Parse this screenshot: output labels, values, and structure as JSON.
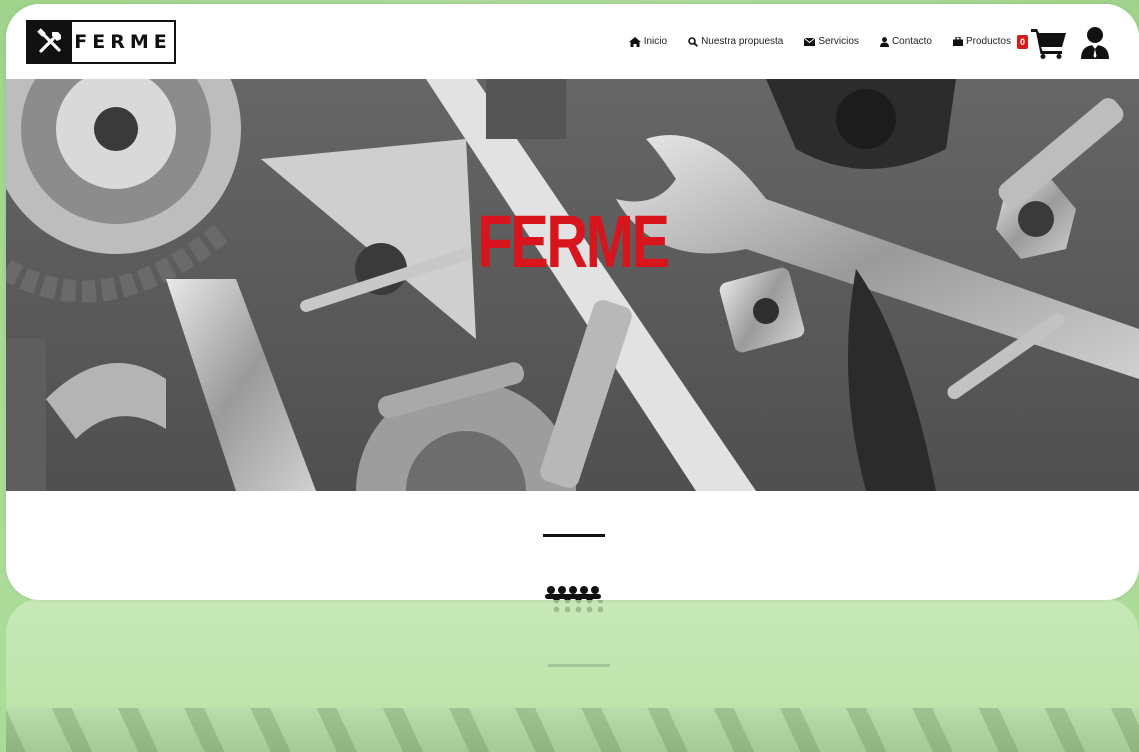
{
  "brand": {
    "logo_text": "FERME",
    "hero_title": "FERME"
  },
  "nav": {
    "items": [
      {
        "icon": "home-icon",
        "label": "Inicio"
      },
      {
        "icon": "search-icon",
        "label": "Nuestra propuesta"
      },
      {
        "icon": "envelope-icon",
        "label": "Servicios"
      },
      {
        "icon": "user-icon",
        "label": "Contacto"
      },
      {
        "icon": "briefcase-icon",
        "label": "Productos"
      }
    ]
  },
  "cart": {
    "count": "0",
    "icon": "shopping-cart-icon"
  },
  "account": {
    "icon": "user-tie-icon"
  },
  "section": {
    "icon": "users-icon"
  },
  "colors": {
    "brand_red": "#d8141c",
    "background_green": "#a9d898",
    "text_dark": "#111111"
  }
}
